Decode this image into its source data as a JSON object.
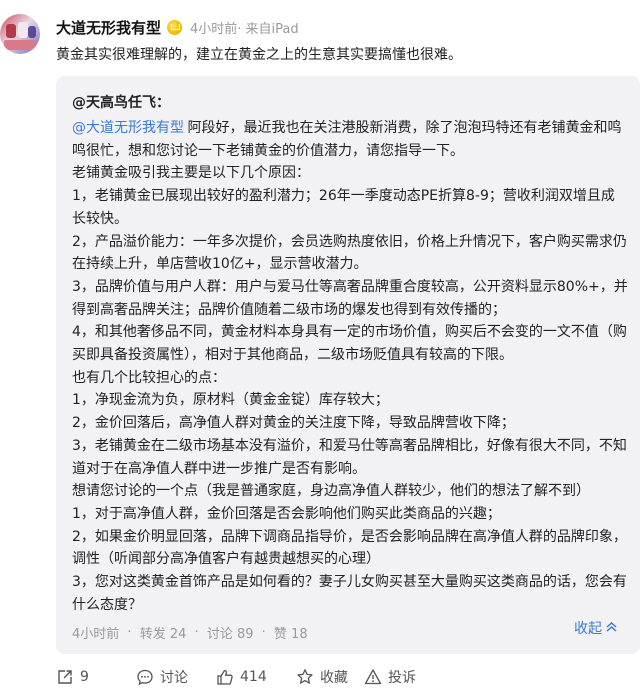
{
  "post": {
    "username": "大道无形我有型",
    "meta": "4小时前· 来自iPad",
    "text": "黄金其实很难理解的，建立在黄金之上的生意其实要搞懂也很难。"
  },
  "repost": {
    "author": "@天高鸟任飞",
    "author_suffix": "：",
    "mention": "@大道无形我有型",
    "lines": [
      "阿段好，最近我也在关注港股新消费，除了泡泡玛特还有老铺黄金和鸣鸣很忙，想和您讨论一下老铺黄金的价值潜力，请您指导一下。",
      "老铺黄金吸引我主要是以下几个原因：",
      "1，老铺黄金已展现出较好的盈利潜力；26年一季度动态PE折算8-9；营收利润双增且成长较快。",
      "2，产品溢价能力：一年多次提价，会员选购热度依旧，价格上升情况下，客户购买需求仍在持续上升，单店营收10亿+，显示营收潜力。",
      "3，品牌价值与用户人群：用户与爱马仕等高奢品牌重合度较高，公开资料显示80%+，并得到高奢品牌关注；品牌价值随着二级市场的爆发也得到有效传播的；",
      "4，和其他奢侈品不同，黄金材料本身具有一定的市场价值，购买后不会变的一文不值（购买即具备投资属性），相对于其他商品，二级市场贬值具有较高的下限。",
      "也有几个比较担心的点：",
      "1，净现金流为负，原材料（黄金金锭）库存较大；",
      "2，金价回落后，高净值人群对黄金的关注度下降，导致品牌营收下降；",
      "3，老铺黄金在二级市场基本没有溢价，和爱马仕等高奢品牌相比，好像有很大不同，不知道对于在高净值人群中进一步推广是否有影响。",
      "想请您讨论的一个点（我是普通家庭，身边高净值人群较少，他们的想法了解不到）",
      "1，对于高净值人群，金价回落是否会影响他们购买此类商品的兴趣；",
      "2，如果金价明显回落，品牌下调商品指导价，是否会影响品牌在高净值人群的品牌印象，调性（听闻部分高净值客户有越贵越想买的心理）",
      "3，您对这类黄金首饰产品是如何看的？妻子儿女购买甚至大量购买这类商品的话，您会有什么态度？"
    ],
    "footer": {
      "time": "4小时前",
      "reposts": "转发 24",
      "comments": "讨论 89",
      "likes": "赞 18",
      "separator": "·"
    },
    "collapse_label": "收起"
  },
  "actions": {
    "share_count": "9",
    "comment_label": "讨论",
    "like_count": "414",
    "favorite_label": "收藏",
    "report_label": "投诉"
  },
  "colors": {
    "accent": "#3b7ad6",
    "muted": "#9a9a9a",
    "repost_bg": "#f2f2f5"
  }
}
